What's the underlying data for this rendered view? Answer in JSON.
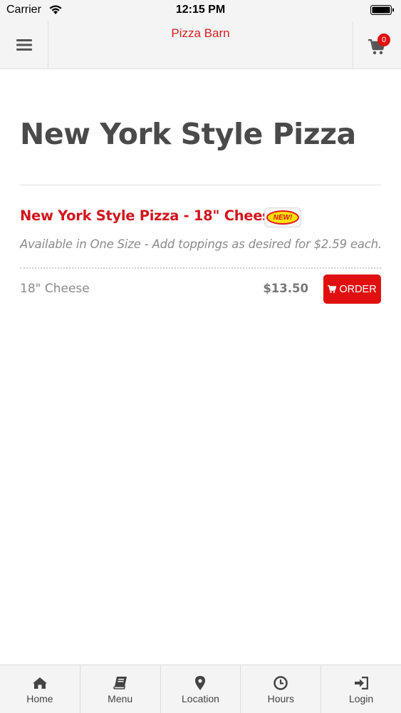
{
  "status_bar": {
    "carrier": "Carrier",
    "time": "12:15 PM"
  },
  "header": {
    "title": "Pizza Barn",
    "cart_count": "0"
  },
  "category": {
    "title": "New York Style Pizza"
  },
  "item": {
    "name": "New York Style Pizza - 18\" Cheese",
    "badge": "NEW!",
    "description": "Available in One Size - Add toppings as desired for $2.59 each.",
    "size_label": "18\" Cheese",
    "price": "$13.50",
    "order_label": "ORDER"
  },
  "tabs": [
    {
      "label": "Home",
      "icon": "home-icon"
    },
    {
      "label": "Menu",
      "icon": "book-icon"
    },
    {
      "label": "Location",
      "icon": "map-pin-icon"
    },
    {
      "label": "Hours",
      "icon": "clock-icon"
    },
    {
      "label": "Login",
      "icon": "login-icon"
    }
  ],
  "colors": {
    "accent": "#e01010",
    "title_red": "#d0161e",
    "header_bg": "#f4f4f4"
  }
}
